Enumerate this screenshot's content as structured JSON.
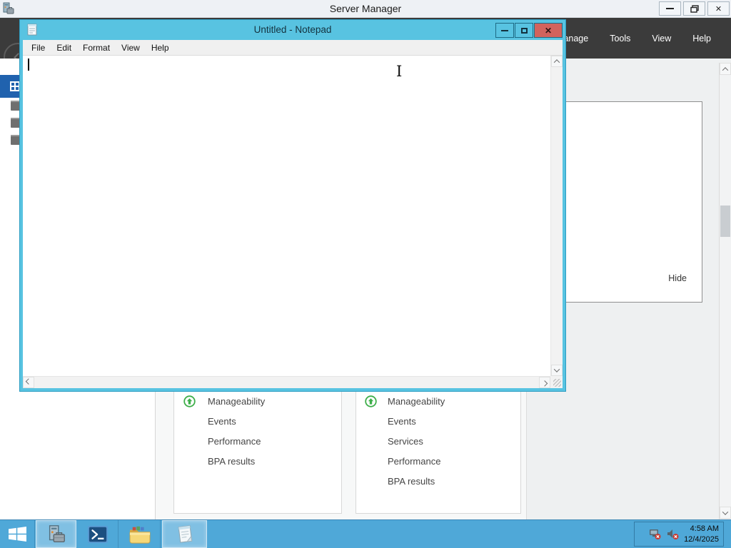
{
  "colors": {
    "notepad_chrome": "#58c3e1",
    "close_button_red": "#d2635d",
    "taskbar_blue": "#4fa8d8",
    "navbar_dark": "#3b3b3b",
    "sidebar_selected_blue": "#2062ae",
    "status_green": "#3dae49"
  },
  "glyphs": {
    "close_x": "✕",
    "ibeam_cursor": "I"
  },
  "server_manager": {
    "title": "Server Manager",
    "menu_items": [
      "Manage",
      "Tools",
      "View",
      "Help"
    ],
    "flyout_hide_label": "Hide",
    "dashboard_tiles": [
      {
        "status": "up",
        "header": "Manageability",
        "rows": [
          "Events",
          "Performance",
          "BPA results"
        ]
      },
      {
        "status": "up",
        "header": "Manageability",
        "rows": [
          "Events",
          "Services",
          "Performance",
          "BPA results"
        ]
      }
    ]
  },
  "notepad": {
    "title": "Untitled - Notepad",
    "menu_items": [
      "File",
      "Edit",
      "Format",
      "View",
      "Help"
    ],
    "content": ""
  },
  "tray": {
    "time": "4:58 AM",
    "date": "12/4/2025"
  }
}
